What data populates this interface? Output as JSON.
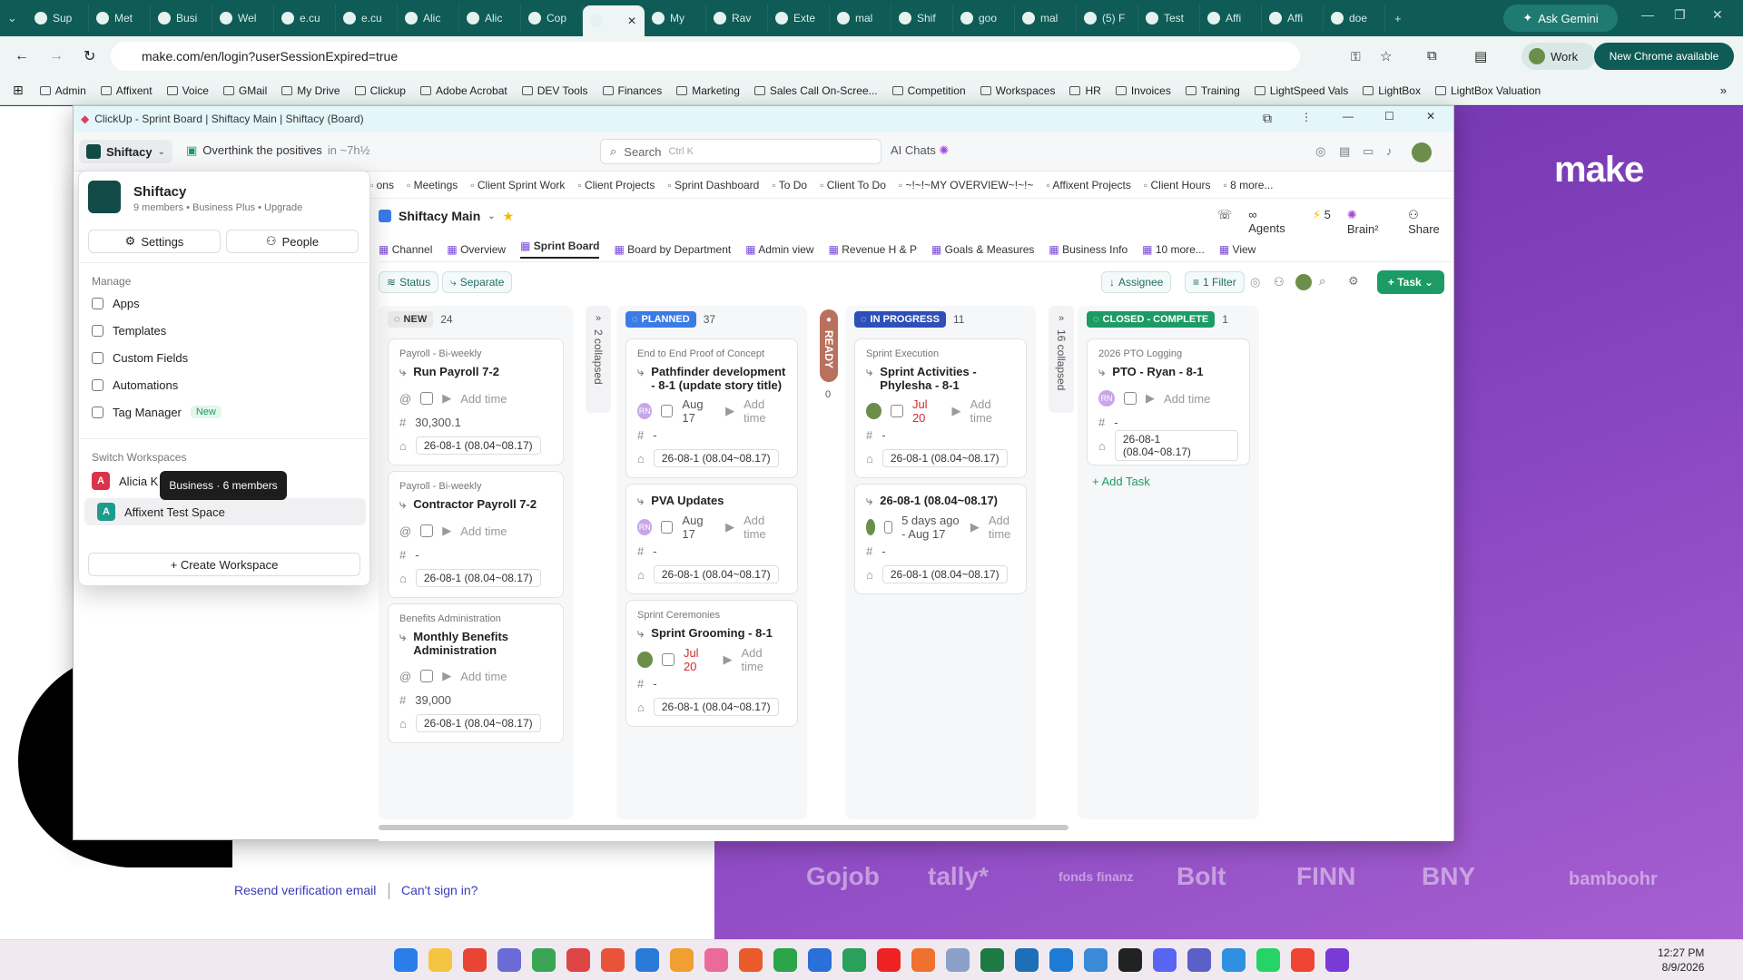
{
  "browser": {
    "tabs": [
      "Sup",
      "Met",
      "Busi",
      "Wel",
      "e.cu",
      "e.cu",
      "Alic",
      "Alic",
      "Cop",
      "",
      "My",
      "Rav",
      "Exte",
      "mal",
      "Shif",
      "goo",
      "mal",
      "(5) F",
      "Test",
      "Affi",
      "Affi",
      "doe"
    ],
    "ask_gemini": "Ask Gemini",
    "url": "make.com/en/login?userSessionExpired=true",
    "profile": "Work",
    "new_chrome": "New Chrome available",
    "bookmarks": [
      "Admin",
      "Affixent",
      "Voice",
      "GMail",
      "My Drive",
      "Clickup",
      "Adobe Acrobat",
      "DEV Tools",
      "Finances",
      "Marketing",
      "Sales Call On-Scree...",
      "Competition",
      "Workspaces",
      "HR",
      "Invoices",
      "Training",
      "LightSpeed Vals",
      "LightBox",
      "LightBox Valuation"
    ]
  },
  "background": {
    "brand": "make",
    "partner_logos": [
      "Gojob",
      "tally*",
      "fonds finanz",
      "Bolt",
      "FINN",
      "BNY",
      "bamboohr"
    ],
    "resend": "Resend verification email",
    "cant_sign_in": "Can't sign in?"
  },
  "clickup": {
    "window_title": "ClickUp - Sprint Board | Shiftacy Main | Shiftacy (Board)",
    "workspace": "Shiftacy",
    "reminder": "Overthink the positives",
    "reminder_time": "in ~7h½",
    "search_placeholder": "Search",
    "search_shortcut": "Ctrl K",
    "ai_chats": "AI Chats",
    "nav_items": [
      "ons",
      "Meetings",
      "Client Sprint Work",
      "Client Projects",
      "Sprint Dashboard",
      "To Do",
      "Client To Do",
      "~!~!~MY OVERVIEW~!~!~",
      "Affixent Projects",
      "Client Hours",
      "8 more..."
    ],
    "space_name": "Shiftacy Main",
    "header_actions": [
      "Agents",
      "5",
      "Brain²",
      "Share"
    ],
    "views": [
      "Channel",
      "Overview",
      "Sprint Board",
      "Board by Department",
      "Admin view",
      "Revenue H & P",
      "Goals & Measures",
      "Business Info",
      "10 more...",
      "View"
    ],
    "filters": {
      "status": "Status",
      "separate": "Separate",
      "assignee": "Assignee",
      "filter": "1 Filter",
      "task": "Task"
    },
    "columns": [
      {
        "name": "NEW",
        "count": "24",
        "color": "#e9e9e9",
        "text": "#333",
        "cards": [
          {
            "parent": "Payroll - Bi-weekly",
            "title": "Run Payroll 7-2",
            "add_time": "Add time",
            "num": "30,300.1",
            "sprint": "26-08-1 (08.04~08.17)"
          },
          {
            "parent": "Payroll - Bi-weekly",
            "title": "Contractor Payroll 7-2",
            "add_time": "Add time",
            "num": "-",
            "sprint": "26-08-1 (08.04~08.17)"
          },
          {
            "parent": "Benefits Administration",
            "title": "Monthly Benefits Administration",
            "add_time": "Add time",
            "num": "39,000",
            "sprint": "26-08-1 (08.04~08.17)"
          }
        ]
      },
      {
        "name": "PLANNED",
        "count": "37",
        "color": "#3a7be8",
        "text": "#fff",
        "cards": [
          {
            "parent": "End to End Proof of Concept",
            "title": "Pathfinder development - 8-1 (update story title)",
            "avatar": "RN",
            "date": "Aug 17",
            "add_time": "Add time",
            "num": "-",
            "sprint": "26-08-1 (08.04~08.17)"
          },
          {
            "parent": "",
            "title": "PVA Updates",
            "avatar": "RN",
            "date": "Aug 17",
            "add_time": "Add time",
            "num": "-",
            "sprint": "26-08-1 (08.04~08.17)"
          },
          {
            "parent": "Sprint Ceremonies",
            "title": "Sprint Grooming - 8-1",
            "date": "Jul 20",
            "add_time": "Add time",
            "num": "-",
            "sprint": "26-08-1 (08.04~08.17)"
          }
        ]
      },
      {
        "name": "IN PROGRESS",
        "count": "11",
        "color": "#2d4fb8",
        "text": "#fff",
        "cards": [
          {
            "parent": "Sprint Execution",
            "title": "Sprint Activities - Phylesha - 8-1",
            "date": "Jul 20",
            "add_time": "Add time",
            "num": "-",
            "sprint": "26-08-1 (08.04~08.17)"
          },
          {
            "parent": "",
            "title": "26-08-1 (08.04~08.17)",
            "date": "5 days ago - Aug 17",
            "add_time": "Add time",
            "num": "-",
            "sprint": "26-08-1 (08.04~08.17)"
          }
        ]
      },
      {
        "name": "CLOSED - COMPLETE",
        "count": "1",
        "color": "#1c9c64",
        "text": "#fff",
        "cards": [
          {
            "parent": "2026 PTO Logging",
            "title": "PTO - Ryan - 8-1",
            "avatar": "RN",
            "add_time": "Add time",
            "num": "-",
            "sprint": "26-08-1 (08.04~08.17)"
          }
        ]
      }
    ],
    "collapsed1": "2 collapsed",
    "ready": "READY",
    "ready_count": "0",
    "collapsed2": "16 collapsed",
    "add_task": "+ Add Task",
    "popup": {
      "ws_name": "Shiftacy",
      "ws_meta": "9 members • Business Plus • Upgrade",
      "settings": "Settings",
      "people": "People",
      "manage": "Manage",
      "items": [
        "Apps",
        "Templates",
        "Custom Fields",
        "Automations",
        "Tag Manager"
      ],
      "new_badge": "New",
      "switch": "Switch Workspaces",
      "ws1": "Alicia K",
      "ws2": "Affixent Test Space",
      "create": "+ Create Workspace",
      "tooltip": "Business · 6 members"
    }
  },
  "taskbar": {
    "time": "12:27 PM",
    "date": "8/9/2026"
  }
}
